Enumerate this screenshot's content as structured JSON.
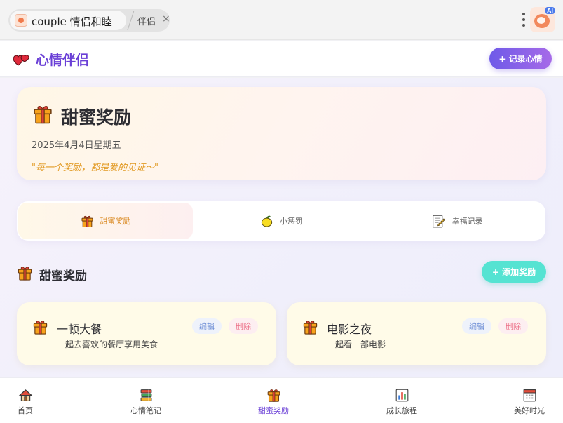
{
  "browser": {
    "tab_title": "couple 情侣和睦",
    "tab2_title": "伴侣",
    "tab2_close": "×",
    "extension_badge": "AI"
  },
  "header": {
    "title": "心情伴侣",
    "record_button": "+ 记录心情"
  },
  "hero": {
    "title": "甜蜜奖励",
    "date": "2025年4月4日星期五",
    "quote": "\"每一个奖励，都是爱的见证～\""
  },
  "tabs": [
    {
      "label": "甜蜜奖励",
      "icon": "gift-icon",
      "active": true
    },
    {
      "label": "小惩罚",
      "icon": "lemon-icon",
      "active": false
    },
    {
      "label": "幸福记录",
      "icon": "memo-icon",
      "active": false
    }
  ],
  "section": {
    "title": "甜蜜奖励",
    "add_button": "+ 添加奖励"
  },
  "rewards": [
    {
      "title": "一顿大餐",
      "description": "一起去喜欢的餐厅享用美食",
      "edit_label": "编辑",
      "delete_label": "删除"
    },
    {
      "title": "电影之夜",
      "description": "一起看一部电影",
      "edit_label": "编辑",
      "delete_label": "删除"
    }
  ],
  "bottom_nav": [
    {
      "label": "首页",
      "icon": "house-icon",
      "active": false
    },
    {
      "label": "心情笔记",
      "icon": "books-icon",
      "active": false
    },
    {
      "label": "甜蜜奖励",
      "icon": "gift-icon",
      "active": true
    },
    {
      "label": "成长旅程",
      "icon": "bar-chart-icon",
      "active": false
    },
    {
      "label": "美好时光",
      "icon": "calendar-icon",
      "active": false
    }
  ],
  "colors": {
    "brand_purple": "#6a3fd6",
    "accent_orange": "#e29a23",
    "add_teal": "#55e3d2",
    "delete_pink": "#ec6e86",
    "edit_blue": "#6f8fd6"
  }
}
